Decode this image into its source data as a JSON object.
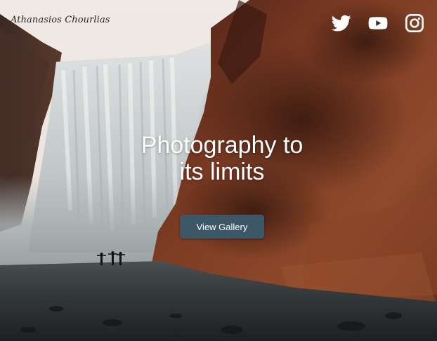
{
  "header": {
    "brand": "Athanasios Chourlias",
    "social": [
      {
        "name": "twitter",
        "icon": "twitter-icon"
      },
      {
        "name": "youtube",
        "icon": "youtube-icon"
      },
      {
        "name": "instagram",
        "icon": "instagram-icon"
      }
    ]
  },
  "hero": {
    "headline_line1": "Photography to",
    "headline_line2": "its limits",
    "cta_label": "View Gallery"
  },
  "colors": {
    "cta_background": "#3e5767",
    "text_light": "#ffffff",
    "brand_text": "#2a2220"
  }
}
